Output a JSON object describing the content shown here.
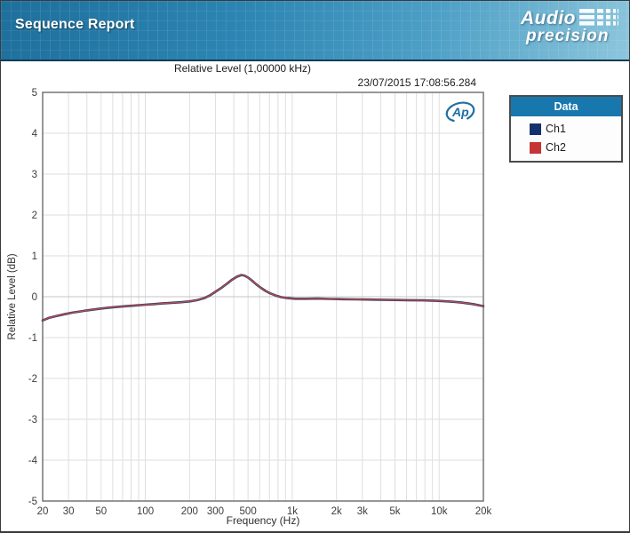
{
  "header": {
    "title": "Sequence Report",
    "logo_word1": "Audio",
    "logo_word2": "precision"
  },
  "report": {
    "chart_title": "Relative Level (1,00000 kHz)",
    "timestamp": "23/07/2015 17:08:56.284",
    "ap_badge": "Ap",
    "ap_badge_color": "#1d6fa5"
  },
  "legend": {
    "title": "Data",
    "items": [
      {
        "label": "Ch1",
        "color": "#14316e"
      },
      {
        "label": "Ch2",
        "color": "#c53535"
      }
    ]
  },
  "chart_data": {
    "type": "line",
    "title": "Relative Level (1,00000 kHz)",
    "xlabel": "Frequency (Hz)",
    "ylabel": "Relative Level (dB)",
    "x_scale": "log",
    "xlim": [
      20,
      20000
    ],
    "ylim": [
      -5,
      5
    ],
    "grid": true,
    "legend_position": "outside-right",
    "x_ticks": [
      {
        "f": 20,
        "label": "20"
      },
      {
        "f": 30,
        "label": "30"
      },
      {
        "f": 50,
        "label": "50"
      },
      {
        "f": 100,
        "label": "100"
      },
      {
        "f": 200,
        "label": "200"
      },
      {
        "f": 300,
        "label": "300"
      },
      {
        "f": 500,
        "label": "500"
      },
      {
        "f": 1000,
        "label": "1k"
      },
      {
        "f": 2000,
        "label": "2k"
      },
      {
        "f": 3000,
        "label": "3k"
      },
      {
        "f": 5000,
        "label": "5k"
      },
      {
        "f": 10000,
        "label": "10k"
      },
      {
        "f": 20000,
        "label": "20k"
      }
    ],
    "y_ticks": [
      5,
      4,
      3,
      2,
      1,
      0,
      -1,
      -2,
      -3,
      -4,
      -5
    ],
    "grid_freqs": [
      30,
      40,
      50,
      60,
      70,
      80,
      90,
      100,
      200,
      300,
      400,
      500,
      600,
      700,
      800,
      900,
      1000,
      2000,
      3000,
      4000,
      5000,
      6000,
      7000,
      8000,
      9000,
      10000
    ],
    "series": [
      {
        "name": "Ch1",
        "color": "#17365d",
        "stroke_width": 2.6
      },
      {
        "name": "Ch2",
        "color": "#bf4a52",
        "stroke_width": 1.4
      }
    ],
    "note": "Ch1 and Ch2 overlap exactly; shared points below as [frequency_hz, relative_level_db]",
    "points": [
      [
        20,
        -0.58
      ],
      [
        22,
        -0.52
      ],
      [
        25,
        -0.47
      ],
      [
        28,
        -0.43
      ],
      [
        32,
        -0.39
      ],
      [
        36,
        -0.36
      ],
      [
        40,
        -0.335
      ],
      [
        45,
        -0.31
      ],
      [
        50,
        -0.29
      ],
      [
        58,
        -0.265
      ],
      [
        66,
        -0.245
      ],
      [
        75,
        -0.23
      ],
      [
        85,
        -0.215
      ],
      [
        100,
        -0.195
      ],
      [
        115,
        -0.18
      ],
      [
        130,
        -0.165
      ],
      [
        150,
        -0.15
      ],
      [
        175,
        -0.135
      ],
      [
        200,
        -0.115
      ],
      [
        225,
        -0.085
      ],
      [
        250,
        -0.04
      ],
      [
        275,
        0.03
      ],
      [
        300,
        0.12
      ],
      [
        330,
        0.22
      ],
      [
        360,
        0.32
      ],
      [
        390,
        0.42
      ],
      [
        420,
        0.49
      ],
      [
        450,
        0.53
      ],
      [
        470,
        0.52
      ],
      [
        500,
        0.47
      ],
      [
        530,
        0.4
      ],
      [
        570,
        0.3
      ],
      [
        610,
        0.22
      ],
      [
        660,
        0.14
      ],
      [
        710,
        0.08
      ],
      [
        770,
        0.03
      ],
      [
        840,
        -0.01
      ],
      [
        930,
        -0.035
      ],
      [
        1050,
        -0.05
      ],
      [
        1250,
        -0.05
      ],
      [
        1500,
        -0.045
      ],
      [
        1800,
        -0.055
      ],
      [
        2200,
        -0.06
      ],
      [
        2700,
        -0.065
      ],
      [
        3300,
        -0.07
      ],
      [
        4000,
        -0.075
      ],
      [
        5000,
        -0.08
      ],
      [
        6200,
        -0.085
      ],
      [
        7800,
        -0.09
      ],
      [
        9500,
        -0.1
      ],
      [
        11500,
        -0.115
      ],
      [
        14000,
        -0.14
      ],
      [
        17000,
        -0.18
      ],
      [
        20000,
        -0.23
      ]
    ],
    "colors": {
      "grid": "#dedede",
      "zero_line": "#c4c4c4",
      "plot_border": "#757575",
      "tick_text": "#3c3c3c"
    }
  }
}
